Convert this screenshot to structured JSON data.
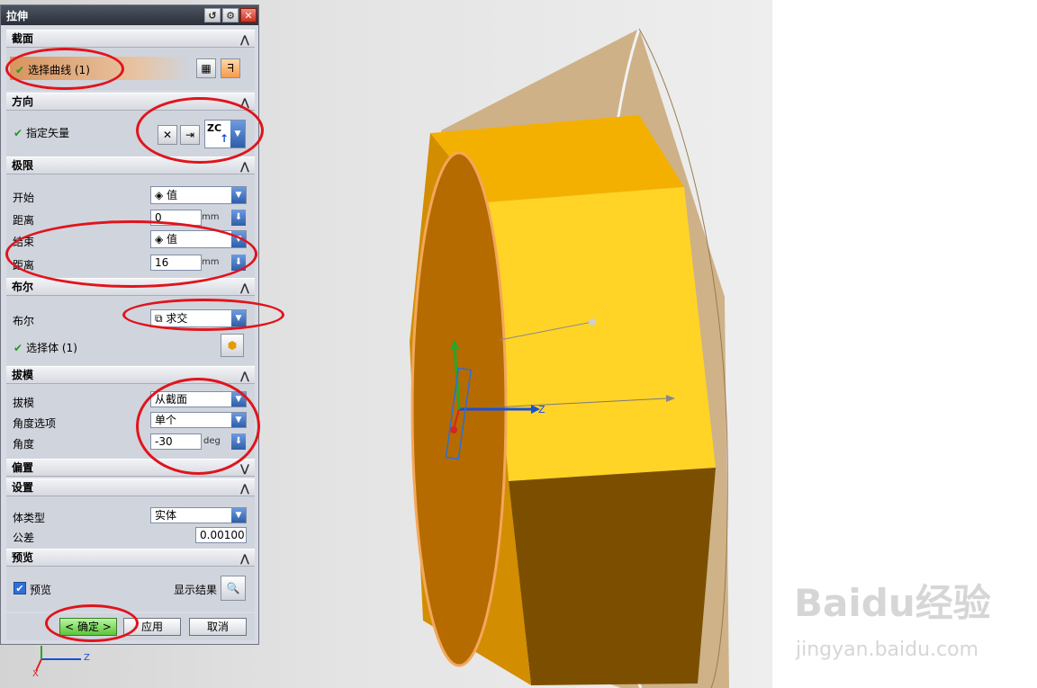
{
  "dialog": {
    "title": "拉伸",
    "sections": {
      "section": {
        "header": "截面",
        "select_curve_label": "选择曲线 (1)"
      },
      "direction": {
        "header": "方向",
        "specify_vector_label": "指定矢量",
        "vector_value": "ZC"
      },
      "limits": {
        "header": "极限",
        "start_label": "开始",
        "start_value": "值",
        "start_distance_label": "距离",
        "start_distance_value": "0",
        "start_distance_unit": "mm",
        "end_label": "结束",
        "end_value": "值",
        "end_distance_label": "距离",
        "end_distance_value": "16",
        "end_distance_unit": "mm"
      },
      "boolean": {
        "header": "布尔",
        "boolean_label": "布尔",
        "boolean_value": "求交",
        "select_body_label": "选择体 (1)"
      },
      "draft": {
        "header": "拔模",
        "draft_label": "拔模",
        "draft_value": "从截面",
        "angle_option_label": "角度选项",
        "angle_option_value": "单个",
        "angle_label": "角度",
        "angle_value": "-30",
        "angle_unit": "deg"
      },
      "offset": {
        "header": "偏置"
      },
      "settings": {
        "header": "设置",
        "body_type_label": "体类型",
        "body_type_value": "实体",
        "tolerance_label": "公差",
        "tolerance_value": "0.00100"
      },
      "preview": {
        "header": "预览",
        "preview_label": "预览",
        "show_result_label": "显示结果"
      }
    },
    "buttons": {
      "ok": "< 确定 >",
      "apply": "应用",
      "cancel": "取消"
    }
  },
  "viewport": {
    "triad_axis_z": "Z",
    "triad_axis_x": "X",
    "dynamic_axis_z": "Z"
  },
  "watermark": {
    "brand": "Baidu经验",
    "url": "jingyan.baidu.com"
  },
  "colors": {
    "annotation": "#e0141c",
    "solid": "#f4b400",
    "cone": "#c8a46e"
  }
}
